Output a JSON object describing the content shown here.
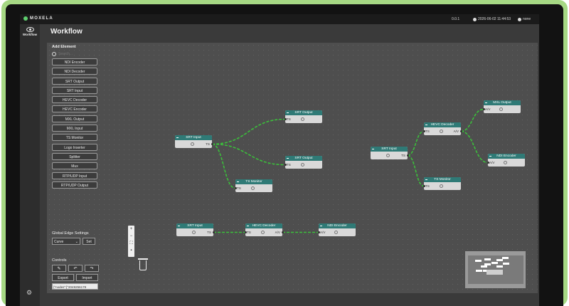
{
  "topbar": {
    "brand": "MOXELA",
    "version": "0.0.1",
    "datetime": "2026-06-02 11:44:53",
    "user": "none"
  },
  "nav": {
    "workflow_label": "Workflow"
  },
  "page": {
    "title": "Workflow"
  },
  "sidebar": {
    "add_title": "Add Element",
    "search_placeholder": "Search...",
    "elements": [
      "NDI Encoder",
      "NDI Decoder",
      "SRT Output",
      "SRT Input",
      "HEVC Decoder",
      "HEVC Encoder",
      "MXL Output",
      "MXL Input",
      "TS Monitor",
      "Logo Inserter",
      "Splitter",
      "Mux",
      "RTP/UDP Input",
      "RTP/UDP Output"
    ]
  },
  "edge_settings": {
    "title": "Global Edge Settings",
    "selected": "Curve",
    "set_label": "Set"
  },
  "controls": {
    "title": "Controls",
    "export_label": "Export",
    "import_label": "Import",
    "json_value": "{\"nodes\":[\"2049256178"
  },
  "zoom": {
    "in": "+",
    "out": "−",
    "fit": "⛶",
    "lock": "▪"
  },
  "colors": {
    "accent": "#2f7a76",
    "edge": "#3bbf3b",
    "brand_dot": "#5fd06f"
  },
  "nodes": [
    {
      "title": "SRT Input",
      "in": "",
      "out": "TS"
    },
    {
      "title": "SRT Output",
      "in": "TS",
      "out": ""
    },
    {
      "title": "SRT Output",
      "in": "TS",
      "out": ""
    },
    {
      "title": "TS Monitor",
      "in": "TS",
      "out": ""
    },
    {
      "title": "SRT Input",
      "in": "",
      "out": "TS"
    },
    {
      "title": "HEVC Decoder",
      "in": "TS",
      "out": "A/V"
    },
    {
      "title": "MXL Output",
      "in": "A/V",
      "out": ""
    },
    {
      "title": "NDI Encoder",
      "in": "A/V",
      "out": ""
    },
    {
      "title": "TS Monitor",
      "in": "TS",
      "out": ""
    },
    {
      "title": "SRT Input",
      "in": "",
      "out": "TS"
    },
    {
      "title": "HEVC Decoder",
      "in": "TS",
      "out": "A/V"
    },
    {
      "title": "NDI Encoder",
      "in": "A/V",
      "out": ""
    }
  ]
}
